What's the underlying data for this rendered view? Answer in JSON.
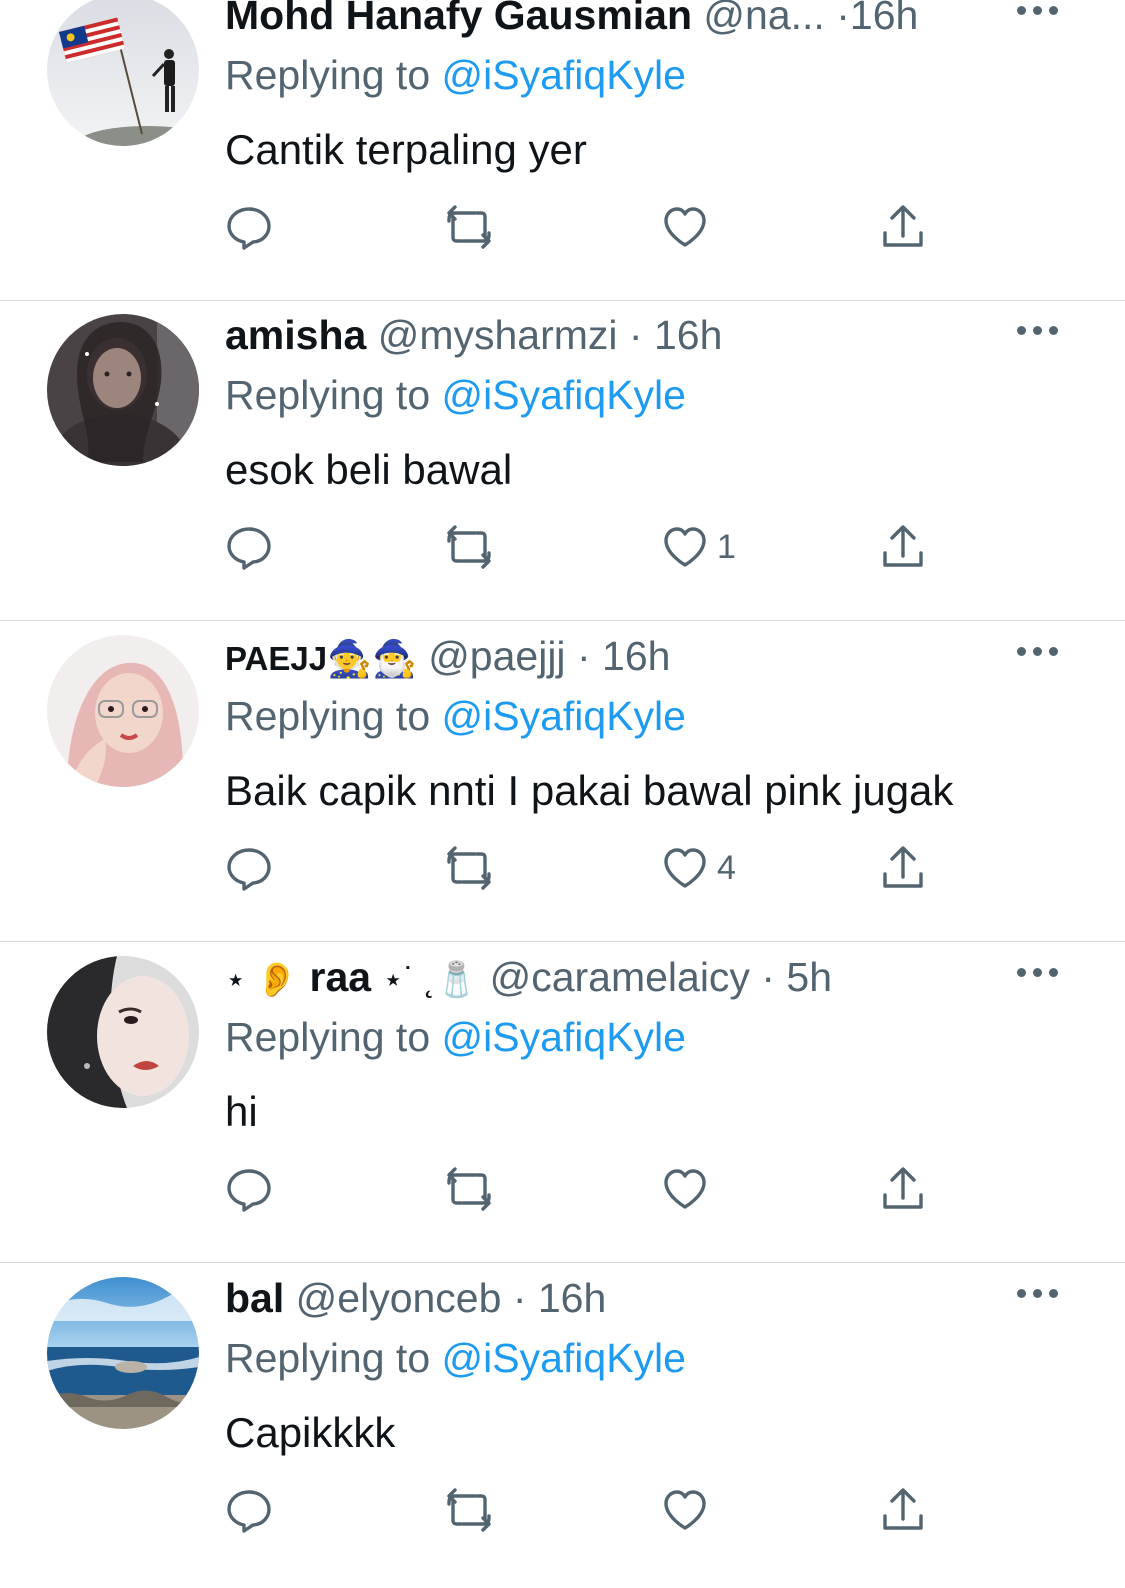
{
  "replying_label": "Replying to",
  "colors": {
    "text": "#0f1419",
    "secondary": "#536471",
    "link": "#1d9bf0",
    "divider": "#cfd9de"
  },
  "icons": [
    "reply-icon",
    "retweet-icon",
    "like-icon",
    "share-icon",
    "more-icon"
  ],
  "tweets": [
    {
      "name": "Mohd Hanafy Gausmian",
      "handle": "@na...",
      "separator": "·",
      "time": "16h",
      "mention": "@iSyafiqKyle",
      "text": "Cantik terpaling yer",
      "like_count": ""
    },
    {
      "name": "amisha",
      "handle": "@mysharmzi",
      "separator": "·",
      "time": "16h",
      "mention": "@iSyafiqKyle",
      "text": "esok beli bawal",
      "like_count": "1"
    },
    {
      "name": "PAEJJ",
      "name_emoji": "🧙🧙‍♂️",
      "handle": "@paejjj",
      "separator": "·",
      "time": "16h",
      "mention": "@iSyafiqKyle",
      "text": "Baik capik nnti I pakai bawal pink jugak",
      "like_count": "4"
    },
    {
      "name": "raa",
      "name_prefix": "⋆ 👂",
      "name_suffix": "⋆˙ ˛🧂",
      "handle": "@caramelaicy",
      "separator": "·",
      "time": "5h",
      "mention": "@iSyafiqKyle",
      "text": "hi",
      "like_count": ""
    },
    {
      "name": "bal",
      "handle": "@elyonceb",
      "separator": "·",
      "time": "16h",
      "mention": "@iSyafiqKyle",
      "text": "Capikkkk",
      "like_count": ""
    }
  ]
}
